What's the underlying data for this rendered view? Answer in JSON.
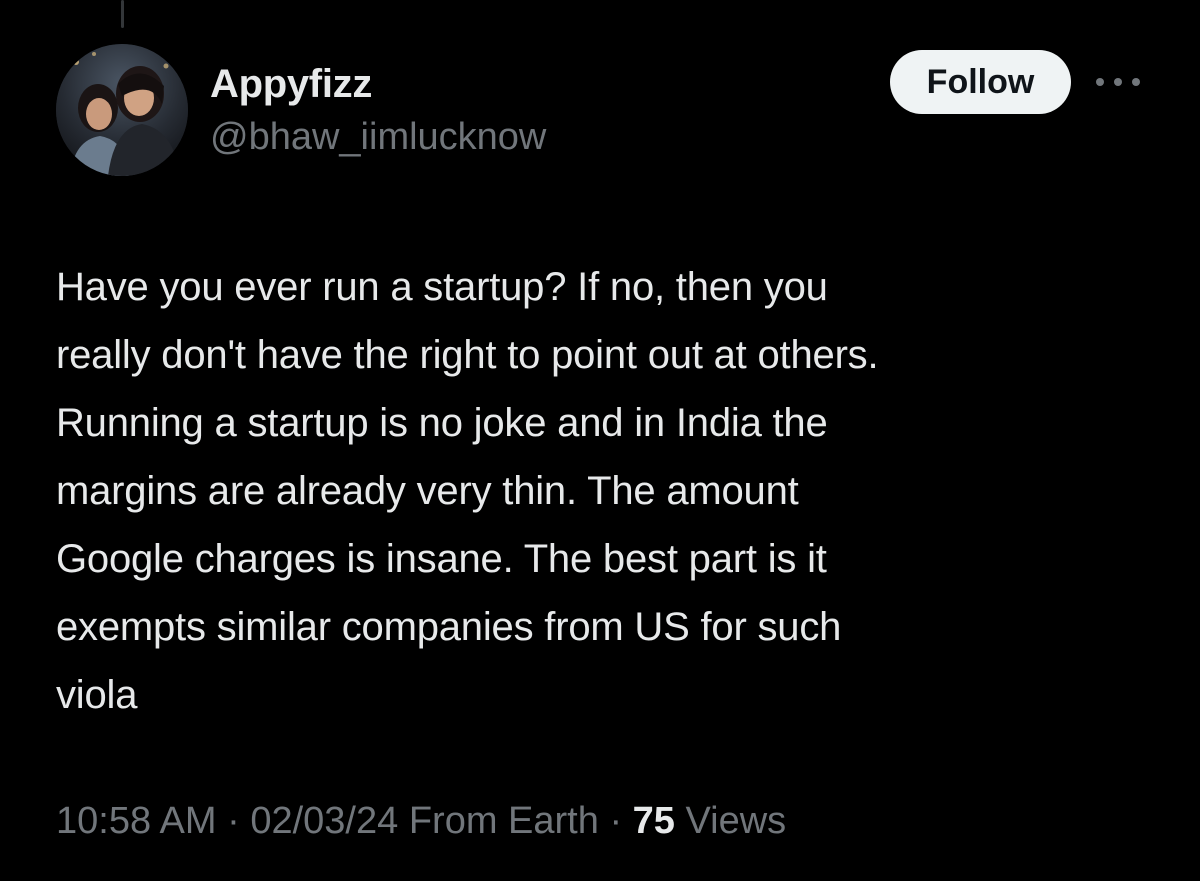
{
  "tweet": {
    "author": {
      "name": "Appyfizz",
      "handle": "@bhaw_iimlucknow"
    },
    "follow_label": "Follow",
    "text_lines": [
      "Have you ever run a startup? If no, then you",
      "really don't have the right to point out at others.",
      "Running a startup is no joke and in India the",
      "margins are already very thin. The amount",
      "Google charges is insane. The best part is it",
      "exempts similar companies from US for such",
      "viola"
    ],
    "meta": {
      "time": "10:58 AM",
      "separator": "·",
      "date": "02/03/24",
      "location": "From Earth",
      "views_count": "75",
      "views_label": "Views"
    }
  },
  "icons": {
    "more": "more-horizontal-icon",
    "avatar": "profile-photo"
  },
  "colors": {
    "background": "#000000",
    "primary_text": "#e7e9ea",
    "secondary_text": "#71767b",
    "follow_button_bg": "#eff3f4",
    "follow_button_text": "#0f1419"
  }
}
